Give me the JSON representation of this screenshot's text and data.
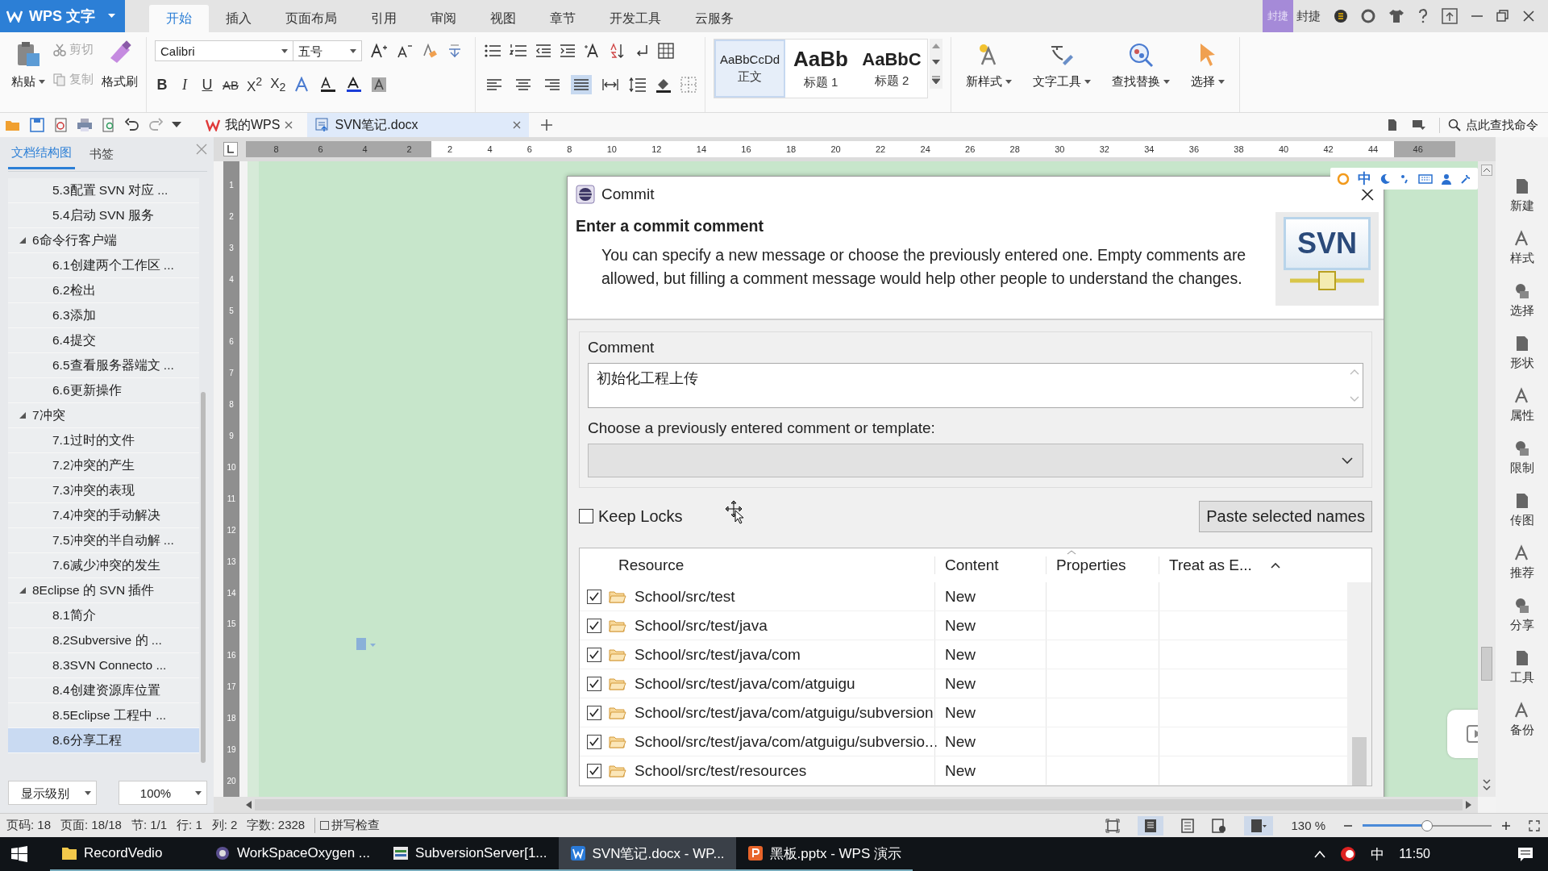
{
  "title_bar": {
    "app_button": "WPS 文字",
    "menu_tabs": [
      {
        "label": "开始",
        "selected": true
      },
      {
        "label": "插入",
        "selected": false
      },
      {
        "label": "页面布局",
        "selected": false
      },
      {
        "label": "引用",
        "selected": false
      },
      {
        "label": "审阅",
        "selected": false
      },
      {
        "label": "视图",
        "selected": false
      },
      {
        "label": "章节",
        "selected": false
      },
      {
        "label": "开发工具",
        "selected": false
      },
      {
        "label": "云服务",
        "selected": false
      }
    ],
    "badge": "封捷",
    "user": "封捷"
  },
  "ribbon": {
    "clipboard": {
      "paste": "粘贴",
      "cut": {
        "label": "剪切",
        "disabled": true
      },
      "copy": {
        "label": "复制",
        "disabled": true
      },
      "format_painter": "格式刷"
    },
    "font": {
      "name": "Calibri",
      "size": "五号",
      "format_buttons": [
        {
          "kind": "bold",
          "text": "B"
        },
        {
          "kind": "italic",
          "text": "I"
        },
        {
          "kind": "underline",
          "text": "U"
        },
        {
          "kind": "strike",
          "text": "AB"
        },
        {
          "kind": "script",
          "text": "X$^{2}$"
        },
        {
          "kind": "script",
          "text": "X$_{2}$"
        }
      ]
    },
    "align_buttons": [
      {
        "selected": false
      },
      {
        "selected": false
      },
      {
        "selected": false
      },
      {
        "selected": true
      },
      {
        "selected": false
      }
    ],
    "styles": [
      {
        "preview": "AaBbCcDd",
        "label": "正文",
        "kind": "normal",
        "selected": true
      },
      {
        "preview": "AaBb",
        "label": "标题 1",
        "kind": "heading",
        "selected": false
      },
      {
        "preview": "AaBbC",
        "label": "标题 2",
        "kind": "subheading",
        "selected": false
      }
    ],
    "tools": [
      "新样式",
      "文字工具",
      "查找替换",
      "选择"
    ]
  },
  "doc_tabs": {
    "tabs": [
      {
        "label": "我的WPS",
        "selected": false
      },
      {
        "label": "SVN笔记.docx",
        "selected": true
      }
    ],
    "command_search": "点此查找命令"
  },
  "nav_pane": {
    "tabs": [
      {
        "label": "文档结构图",
        "selected": true
      },
      {
        "label": "书签",
        "selected": false
      }
    ],
    "tree_top_children": [
      "5.3配置 SVN 对应 ...",
      "5.4启动 SVN 服务"
    ],
    "tree": [
      {
        "label": "6命令行客户端",
        "expanded": true,
        "children": [
          {
            "label": "6.1创建两个工作区 ...",
            "selected": false
          },
          {
            "label": "6.2检出",
            "selected": false
          },
          {
            "label": "6.3添加",
            "selected": false
          },
          {
            "label": "6.4提交",
            "selected": false
          },
          {
            "label": "6.5查看服务器端文 ...",
            "selected": false
          },
          {
            "label": "6.6更新操作",
            "selected": false
          }
        ]
      },
      {
        "label": "7冲突",
        "expanded": true,
        "children": [
          {
            "label": "7.1过时的文件",
            "selected": false
          },
          {
            "label": "7.2冲突的产生",
            "selected": false
          },
          {
            "label": "7.3冲突的表现",
            "selected": false
          },
          {
            "label": "7.4冲突的手动解决",
            "selected": false
          },
          {
            "label": "7.5冲突的半自动解 ...",
            "selected": false
          },
          {
            "label": "7.6减少冲突的发生",
            "selected": false
          }
        ]
      },
      {
        "label": "8Eclipse 的 SVN 插件",
        "expanded": true,
        "children": [
          {
            "label": "8.1简介",
            "selected": false
          },
          {
            "label": "8.2Subversive 的 ...",
            "selected": false
          },
          {
            "label": "8.3SVN Connecto ...",
            "selected": false
          },
          {
            "label": "8.4创建资源库位置",
            "selected": false
          },
          {
            "label": "8.5Eclipse 工程中 ...",
            "selected": false
          },
          {
            "label": "8.6分享工程",
            "selected": true
          }
        ]
      }
    ],
    "level_dropdown": "显示级别",
    "zoom_dropdown": "100%"
  },
  "ruler": {
    "left_labels": [
      "8",
      "6",
      "4",
      "2"
    ],
    "right_labels": [
      "2",
      "4",
      "6",
      "8",
      "10",
      "12",
      "14",
      "16",
      "18",
      "20",
      "22",
      "24",
      "26",
      "28",
      "30",
      "32",
      "34",
      "36",
      "38",
      "40",
      "42",
      "44",
      "46"
    ],
    "vertical_labels": [
      "1",
      "2",
      "3",
      "4",
      "5",
      "6",
      "7",
      "8",
      "9",
      "10",
      "11",
      "12",
      "13",
      "14",
      "15",
      "16",
      "17",
      "18",
      "19",
      "20"
    ]
  },
  "dialog": {
    "title": "Commit",
    "heading": "Enter a commit comment",
    "description": "You can specify a new message or choose the previously entered one. Empty comments are allowed, but filling a comment message would help other people to understand the changes.",
    "logo": "SVN",
    "comment_label": "Comment",
    "comment": "初始化工程上传",
    "template_label": "Choose a previously entered comment or template:",
    "keep_locks": {
      "label": "Keep Locks",
      "checked": false
    },
    "paste_button": "Paste selected names",
    "columns": [
      "Resource",
      "Content",
      "Properties",
      "Treat as E..."
    ],
    "rows": [
      {
        "checked": true,
        "resource": "School/src/test",
        "content": "New"
      },
      {
        "checked": true,
        "resource": "School/src/test/java",
        "content": "New"
      },
      {
        "checked": true,
        "resource": "School/src/test/java/com",
        "content": "New"
      },
      {
        "checked": true,
        "resource": "School/src/test/java/com/atguigu",
        "content": "New"
      },
      {
        "checked": true,
        "resource": "School/src/test/java/com/atguigu/subversion",
        "content": "New"
      },
      {
        "checked": true,
        "resource": "School/src/test/java/com/atguigu/subversio...",
        "content": "New"
      },
      {
        "checked": true,
        "resource": "School/src/test/resources",
        "content": "New"
      }
    ]
  },
  "ime_bar": {
    "mode": "中"
  },
  "side_panel": [
    "新建",
    "样式",
    "选择",
    "形状",
    "属性",
    "限制",
    "传图",
    "推荐",
    "分享",
    "工具",
    "备份"
  ],
  "status_bar": {
    "items": [
      "页码: 18",
      "页面: 18/18",
      "节: 1/1",
      "行: 1",
      "列: 2",
      "字数: 2328"
    ],
    "spell_check": {
      "label": "拼写检查",
      "checked": false
    },
    "zoom": "130 %",
    "zoom_slider": {
      "level": 0.5
    }
  },
  "taskbar": {
    "items": [
      {
        "label": "RecordVedio",
        "selected": false
      },
      {
        "label": "WorkSpaceOxygen ...",
        "selected": false
      },
      {
        "label": "SubversionServer[1...",
        "selected": false
      },
      {
        "label": "SVN笔记.docx - WP...",
        "selected": true
      },
      {
        "label": "黑板.pptx - WPS 演示",
        "selected": false
      }
    ],
    "ime": "中",
    "time": "11:50"
  }
}
